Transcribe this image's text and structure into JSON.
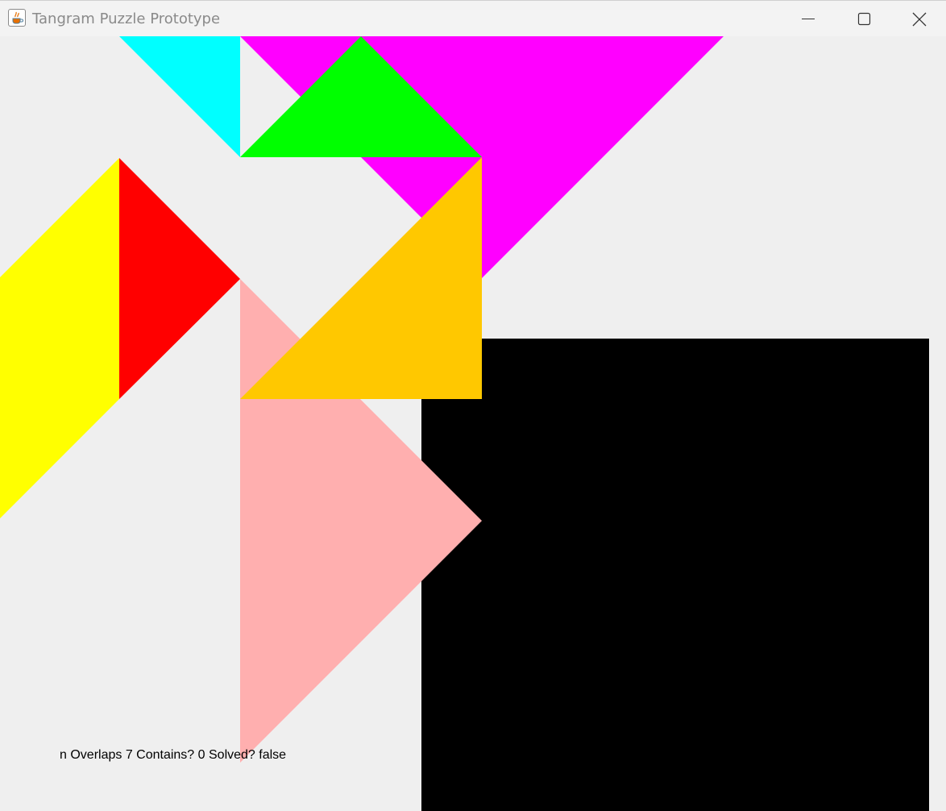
{
  "window": {
    "title": "Tangram Puzzle Prototype",
    "app_icon": "java-cup-icon",
    "controls": {
      "minimize_icon": "minimize-icon",
      "maximize_icon": "maximize-icon",
      "close_icon": "close-icon"
    }
  },
  "board": {
    "target_region_color": "#000000",
    "background_color": "#efefef",
    "pieces": [
      {
        "name": "cyan-small-triangle",
        "color": "#00ffff"
      },
      {
        "name": "magenta-large-triangle",
        "color": "#ff00ff"
      },
      {
        "name": "green-small-triangle",
        "color": "#00ff00"
      },
      {
        "name": "yellow-parallelogram",
        "color": "#ffff00"
      },
      {
        "name": "red-square-half-triangle",
        "color": "#ff0000"
      },
      {
        "name": "orange-medium-triangle",
        "color": "#ffc800"
      },
      {
        "name": "pink-large-triangle",
        "color": "#ffafaf"
      }
    ]
  },
  "status": {
    "text": "n Overlaps 7 Contains? 0 Solved? false"
  }
}
